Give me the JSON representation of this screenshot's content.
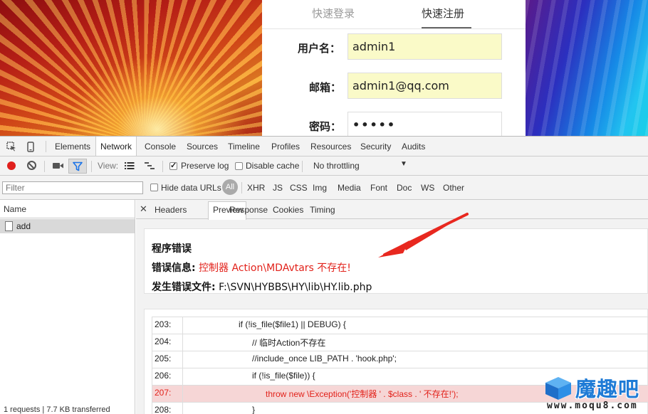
{
  "signup_form": {
    "tab_login": "快速登录",
    "tab_signup": "快速注册",
    "username_label": "用户名：",
    "username_value": "admin1",
    "email_label": "邮箱：",
    "email_value": "admin1@qq.com",
    "password_label": "密码：",
    "password_value": "•••••"
  },
  "devtools": {
    "tabs": [
      "Elements",
      "Network",
      "Console",
      "Sources",
      "Timeline",
      "Profiles",
      "Resources",
      "Security",
      "Audits"
    ],
    "active_tab": "Network",
    "toolbar": {
      "view_label": "View:",
      "preserve_log": "Preserve log",
      "preserve_log_checked": true,
      "disable_cache": "Disable cache",
      "disable_cache_checked": false,
      "throttle": "No throttling"
    },
    "filterbar": {
      "filter_placeholder": "Filter",
      "hide_data_urls": "Hide data URLs",
      "all": "All",
      "types": [
        "XHR",
        "JS",
        "CSS",
        "Img",
        "Media",
        "Font",
        "Doc",
        "WS",
        "Other"
      ]
    },
    "request_list": {
      "header": "Name",
      "items": [
        "add"
      ],
      "status": "1 requests | 7.7 KB transferred"
    },
    "detail_tabs": [
      "Headers",
      "Preview",
      "Response",
      "Cookies",
      "Timing"
    ],
    "active_detail_tab": "Preview",
    "preview": {
      "title": "程序错误",
      "error_label": "错误信息:",
      "error_message": "控制器 Action\\MDAvtars 不存在!",
      "file_label": "发生错误文件:",
      "file_path": "F:\\SVN\\HYBBS\\HY\\lib\\HY.lib.php",
      "code": [
        {
          "num": "203:",
          "src": "if (!is_file($file1) || DEBUG) {",
          "highlight": false
        },
        {
          "num": "204:",
          "src": "// 临时Action不存在",
          "highlight": false
        },
        {
          "num": "205:",
          "src": "//include_once LIB_PATH . 'hook.php';",
          "highlight": false
        },
        {
          "num": "206:",
          "src": "if (!is_file($file)) {",
          "highlight": false
        },
        {
          "num": "207:",
          "src": "throw new \\Exception('控制器 ' . $class . ' 不存在!');",
          "highlight": true
        },
        {
          "num": "208:",
          "src": "}",
          "highlight": false
        }
      ]
    }
  },
  "watermark": {
    "brand": "魔趣吧",
    "url": "www.moqu8.com"
  },
  "colors": {
    "error_red": "#e2221b",
    "record_red": "#e0201d",
    "watermark_blue": "#1f7bd6"
  }
}
